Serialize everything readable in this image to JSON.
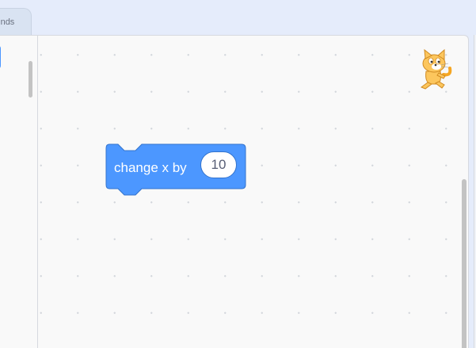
{
  "category_tab": {
    "label": "Sounds"
  },
  "workspace": {
    "block": {
      "label": "change x by",
      "value": "10",
      "color": "#4c97ff",
      "border_color": "#3373cc"
    },
    "sprite": {
      "icon": "scratch-cat-icon"
    }
  },
  "colors": {
    "workspace_bg": "#f9f9f9",
    "page_bg": "#e5ecfb",
    "motion_blue": "#4c97ff"
  }
}
